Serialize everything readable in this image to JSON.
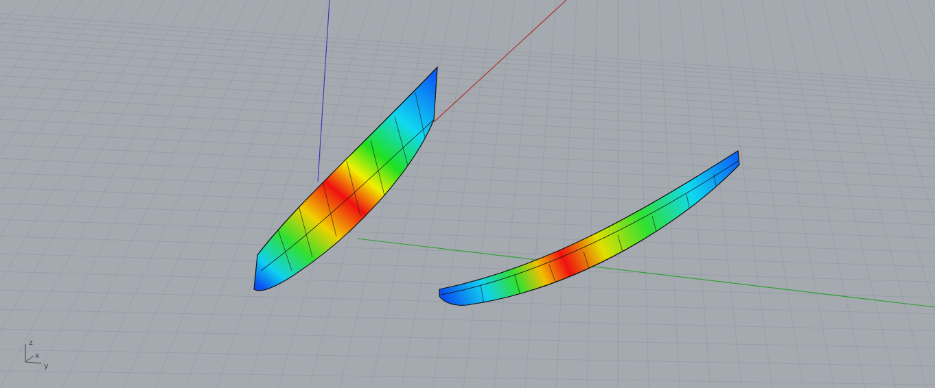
{
  "viewport": {
    "axis_labels": [
      {
        "kind": "z",
        "label": "z"
      },
      {
        "kind": "x",
        "label": "x"
      },
      {
        "kind": "y",
        "label": "y"
      }
    ]
  }
}
